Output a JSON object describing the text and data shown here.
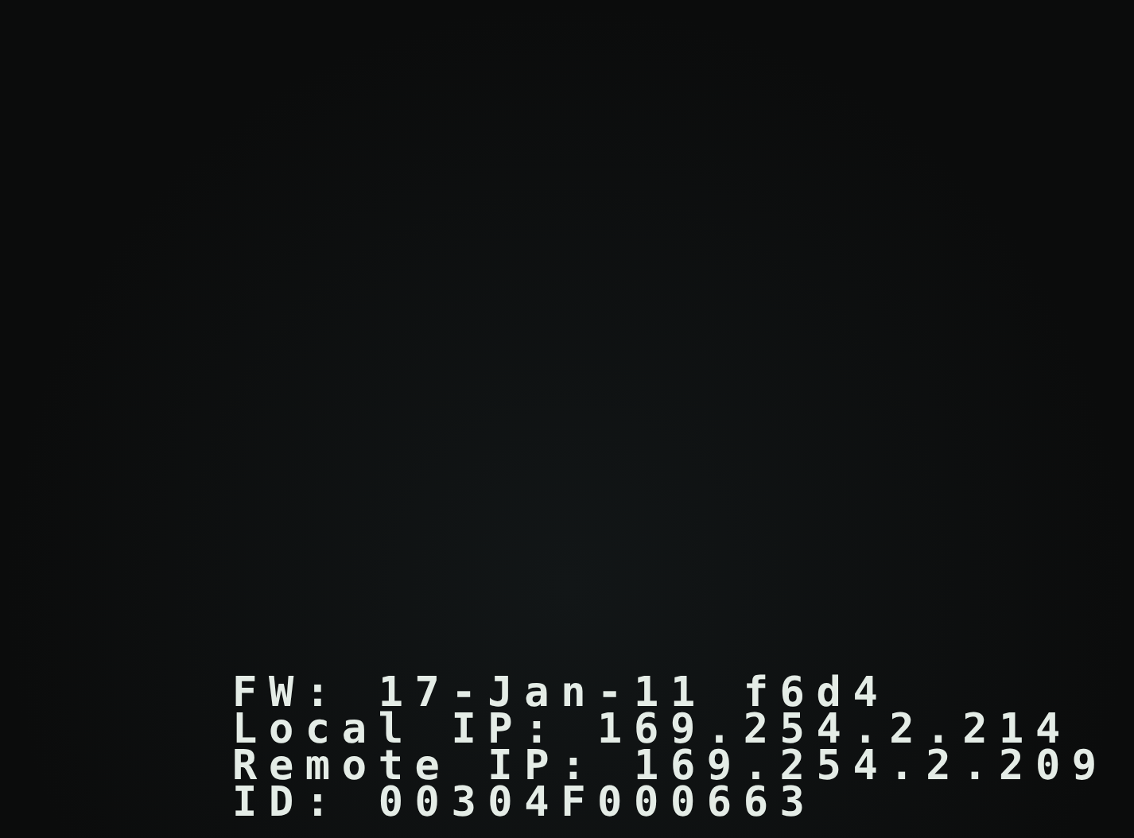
{
  "status_lines": [
    {
      "label": "FW:",
      "value": "17-Jan-11 f6d4"
    },
    {
      "label": "Local IP:",
      "value": "169.254.2.214"
    },
    {
      "label": "Remote IP:",
      "value": "169.254.2.209"
    },
    {
      "label": "ID:",
      "value": "00304F000663"
    }
  ]
}
